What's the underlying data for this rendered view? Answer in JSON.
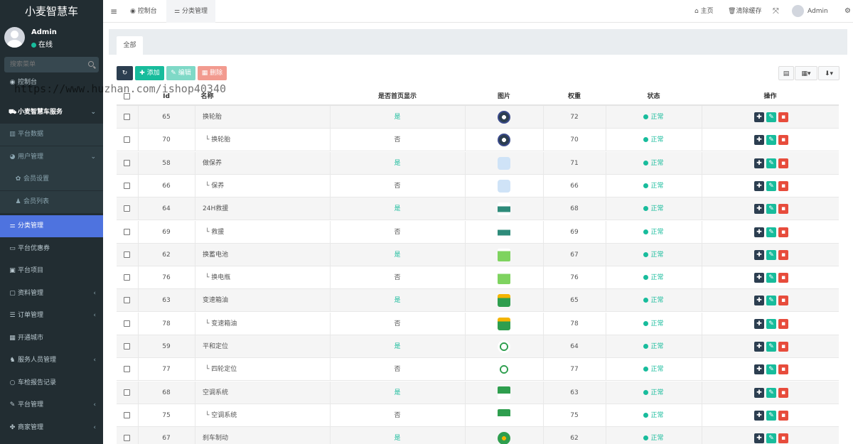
{
  "sidebar": {
    "logo": "小麦智慧车",
    "user": {
      "name": "Admin",
      "status": "在线"
    },
    "search_placeholder": "搜索菜单",
    "items": [
      {
        "label": "控制台",
        "icon": "dashboard-icon",
        "kind": "top"
      },
      {
        "label": "小麦智慧车服务",
        "icon": "car-icon",
        "kind": "header",
        "arrow": "⌄"
      },
      {
        "label": "平台数据",
        "icon": "chart-icon",
        "kind": "sub"
      },
      {
        "label": "用户管理",
        "icon": "user-icon",
        "kind": "sub",
        "arrow": "⌄"
      },
      {
        "label": "会员设置",
        "icon": "gear-icon",
        "kind": "sub2"
      },
      {
        "label": "会员列表",
        "icon": "person-icon",
        "kind": "sub2"
      },
      {
        "label": "分类管理",
        "icon": "sliders-icon",
        "kind": "active"
      },
      {
        "label": "平台优惠券",
        "icon": "ticket-icon",
        "kind": "top"
      },
      {
        "label": "平台项目",
        "icon": "briefcase-icon",
        "kind": "top"
      },
      {
        "label": "资料管理",
        "icon": "folder-icon",
        "kind": "top",
        "arrow": "‹"
      },
      {
        "label": "订单管理",
        "icon": "list-icon",
        "kind": "top",
        "arrow": "‹"
      },
      {
        "label": "开通城市",
        "icon": "map-icon",
        "kind": "top"
      },
      {
        "label": "服务人员管理",
        "icon": "users-icon",
        "kind": "top",
        "arrow": "‹"
      },
      {
        "label": "车检报告记录",
        "icon": "circle-icon",
        "kind": "top"
      },
      {
        "label": "平台管理",
        "icon": "wrench-icon",
        "kind": "top",
        "arrow": "‹"
      },
      {
        "label": "商家管理",
        "icon": "paw-icon",
        "kind": "top",
        "arrow": "‹"
      }
    ]
  },
  "topbar": {
    "tab_dashboard": "控制台",
    "tab_category": "分类管理",
    "home": "主页",
    "clear_cache": "清除缓存",
    "admin": "Admin"
  },
  "panel": {
    "tab_all": "全部"
  },
  "toolbar": {
    "add": "添加",
    "edit": "编辑",
    "delete": "删除"
  },
  "table": {
    "headers": {
      "id": "Id",
      "name": "名称",
      "is_home": "是否首页显示",
      "image": "图片",
      "weight": "权重",
      "status": "状态",
      "ops": "操作"
    },
    "rows": [
      {
        "id": "65",
        "name": "换轮胎",
        "home": "是",
        "weight": "72",
        "status": "正常",
        "pic": "tire",
        "child": false
      },
      {
        "id": "70",
        "name": "└ 换轮胎",
        "home": "否",
        "weight": "70",
        "status": "正常",
        "pic": "tire",
        "child": true
      },
      {
        "id": "58",
        "name": "做保养",
        "home": "是",
        "weight": "71",
        "status": "正常",
        "pic": "maint",
        "child": false
      },
      {
        "id": "66",
        "name": "└ 保养",
        "home": "否",
        "weight": "66",
        "status": "正常",
        "pic": "maint",
        "child": true
      },
      {
        "id": "64",
        "name": "24H救援",
        "home": "是",
        "weight": "68",
        "status": "正常",
        "pic": "rescue",
        "child": false
      },
      {
        "id": "69",
        "name": "└ 救援",
        "home": "否",
        "weight": "69",
        "status": "正常",
        "pic": "rescue",
        "child": true
      },
      {
        "id": "62",
        "name": "换蓄电池",
        "home": "是",
        "weight": "67",
        "status": "正常",
        "pic": "battery",
        "child": false
      },
      {
        "id": "76",
        "name": "└ 换电瓶",
        "home": "否",
        "weight": "76",
        "status": "正常",
        "pic": "battery",
        "child": true
      },
      {
        "id": "63",
        "name": "变速箱油",
        "home": "是",
        "weight": "65",
        "status": "正常",
        "pic": "oil",
        "child": false
      },
      {
        "id": "78",
        "name": "└ 变速箱油",
        "home": "否",
        "weight": "78",
        "status": "正常",
        "pic": "oil",
        "child": true
      },
      {
        "id": "59",
        "name": "平和定位",
        "home": "是",
        "weight": "64",
        "status": "正常",
        "pic": "align",
        "child": false
      },
      {
        "id": "77",
        "name": "└ 四轮定位",
        "home": "否",
        "weight": "77",
        "status": "正常",
        "pic": "align",
        "child": true
      },
      {
        "id": "68",
        "name": "空调系统",
        "home": "是",
        "weight": "63",
        "status": "正常",
        "pic": "ac",
        "child": false
      },
      {
        "id": "75",
        "name": "└ 空调系统",
        "home": "否",
        "weight": "75",
        "status": "正常",
        "pic": "ac",
        "child": true
      },
      {
        "id": "67",
        "name": "刹车制动",
        "home": "是",
        "weight": "62",
        "status": "正常",
        "pic": "brake",
        "child": false
      }
    ]
  },
  "watermark": "https://www.huzhan.com/ishop40340",
  "colors": {
    "sidebar": "#222d32",
    "active": "#4e73df",
    "green": "#18bc9c",
    "red": "#e74c3c",
    "dark": "#2c3e50"
  }
}
